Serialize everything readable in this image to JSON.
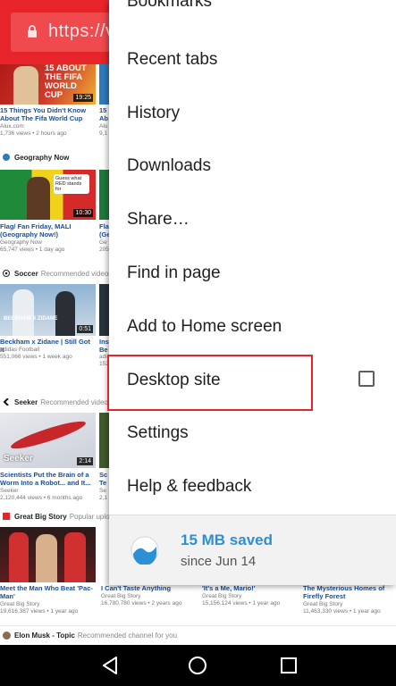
{
  "url_bar": {
    "url_text": "https://v"
  },
  "feed": {
    "top_videos": [
      {
        "title": "15 Things You Didn't Know About The Fifa World Cup",
        "channel": "Alux.com",
        "meta": "1,736 views • 2 hours ago",
        "duration": "19:25",
        "thumb_text_1": "15 ABOUT",
        "thumb_text_2": "THE FIFA",
        "thumb_text_3": "WORLD CUP"
      }
    ],
    "sections": [
      {
        "name": "Geography Now",
        "subtitle": "",
        "video": {
          "title": "Flag/ Fan Friday, MALI (Geography Now!)",
          "channel": "Geography Now",
          "meta": "65,747 views • 1 day ago",
          "duration": "10:30",
          "bubble": "Guess what RED stands for"
        }
      },
      {
        "name": "Soccer",
        "subtitle": "Recommended videos for you",
        "video": {
          "title": "Beckham x Zidane | Still Got It",
          "channel": "adidas Football",
          "meta": "551,066 views • 1 week ago",
          "duration": "0:51",
          "thumb_text": "BECKHAM X ZIDANE"
        }
      },
      {
        "name": "Seeker",
        "subtitle": "Recommended videos for you",
        "video": {
          "title": "Scientists Put the Brain of a Worm Into a Robot... and It...",
          "channel": "Seeker",
          "meta": "2,120,444 views • 6 months ago",
          "duration": "2:14",
          "thumb_text": "Seeker"
        }
      },
      {
        "name": "Great Big Story",
        "subtitle": "Popular uploads",
        "video": {
          "title": "Meet the Man Who Beat 'Pac-Man'",
          "channel": "Great Big Story",
          "meta": "19,616,387 views • 1 year ago",
          "duration": ""
        }
      }
    ],
    "bottom_row": [
      {
        "title": "I Can't Taste Anything",
        "channel": "Great Big Story",
        "meta": "16,780,780 views • 2 years ago"
      },
      {
        "title": "'It's a Me, Mario!'",
        "channel": "Great Big Story",
        "meta": "15,156,124 views • 1 year ago"
      },
      {
        "title": "The Mysterious Homes of Firefly Forest",
        "channel": "Great Big Story",
        "meta": "11,463,330 views • 1 year ago"
      }
    ],
    "partial_col": [
      {
        "title": "15",
        "line2": "Ab",
        "meta": "Alu",
        "meta2": "9,1"
      },
      {
        "title": "Fla",
        "line2": "(Ge",
        "meta": "Ge",
        "meta2": "205"
      },
      {
        "title": "Ins",
        "line2": "Be",
        "meta": "adi",
        "meta2": "152"
      },
      {
        "title": "Sc",
        "line2": "Te",
        "meta": "Se",
        "meta2": "2,1"
      }
    ],
    "channel_strip": {
      "name": "Elon Musk - Topic",
      "subtitle": "Recommended channel for you"
    }
  },
  "menu": {
    "partial_top_label": "Bookmarks",
    "items": [
      {
        "label": "Recent tabs"
      },
      {
        "label": "History"
      },
      {
        "label": "Downloads"
      },
      {
        "label": "Share…"
      },
      {
        "label": "Find in page"
      },
      {
        "label": "Add to Home screen"
      },
      {
        "label": "Desktop site",
        "checkbox": false
      },
      {
        "label": "Settings"
      },
      {
        "label": "Help & feedback"
      }
    ],
    "savings": {
      "amount": "15 MB saved",
      "since": "since Jun 14"
    }
  },
  "colors": {
    "accent_red": "#e8242b",
    "link_blue": "#1a4d96",
    "savings_blue": "#2d8fd6"
  },
  "icons": {
    "lock": "lock-icon",
    "back": "back-icon",
    "home": "home-icon",
    "recents": "recents-icon",
    "savings": "data-saver-icon"
  }
}
